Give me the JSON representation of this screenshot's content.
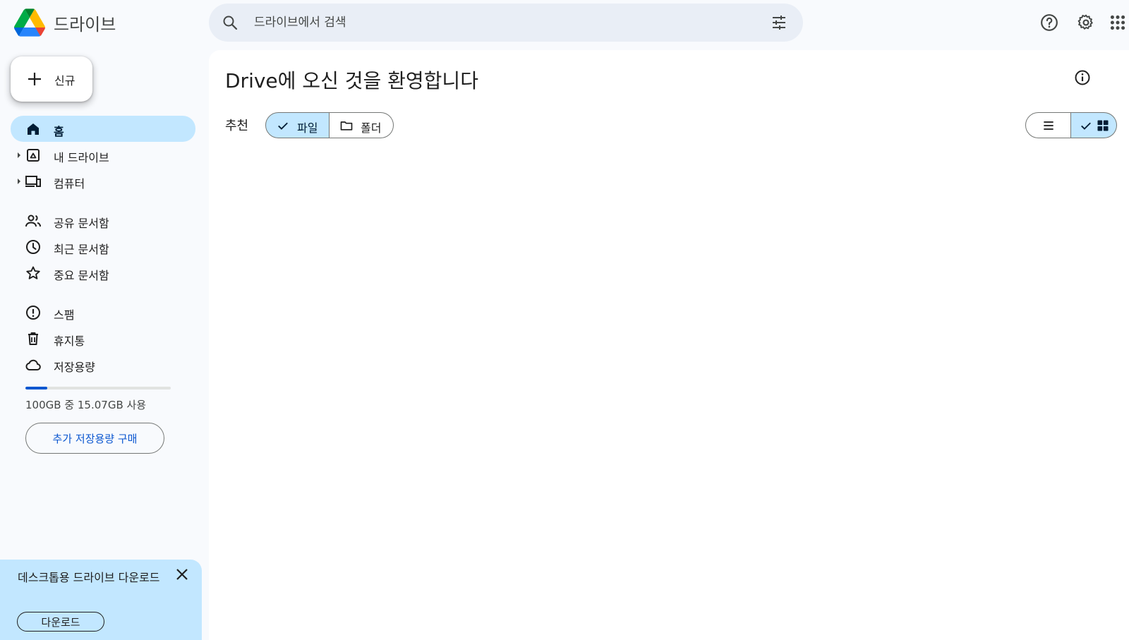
{
  "app": {
    "name": "드라이브",
    "logo_colors": [
      "#0066da",
      "#00ac47",
      "#ea4335",
      "#00832d",
      "#2684fc",
      "#ffba00"
    ]
  },
  "search": {
    "placeholder": "드라이브에서 검색",
    "value": ""
  },
  "header": {
    "icons": [
      "help-icon",
      "settings-icon",
      "apps-grid-icon"
    ]
  },
  "sidebar": {
    "new_label": "신규",
    "items": [
      {
        "label": "홈",
        "icon": "home-icon",
        "active": true
      },
      {
        "label": "내 드라이브",
        "icon": "my-drive-icon",
        "expandable": true
      },
      {
        "label": "컴퓨터",
        "icon": "computers-icon",
        "expandable": true
      },
      {
        "label": "공유 문서함",
        "icon": "shared-icon"
      },
      {
        "label": "최근 문서함",
        "icon": "clock-icon"
      },
      {
        "label": "중요 문서함",
        "icon": "star-icon"
      },
      {
        "label": "스팸",
        "icon": "spam-icon"
      },
      {
        "label": "휴지통",
        "icon": "trash-icon"
      },
      {
        "label": "저장용량",
        "icon": "cloud-icon"
      }
    ],
    "storage": {
      "text": "100GB 중 15.07GB 사용",
      "used_fraction": 0.1507
    },
    "buy_storage_label": "추가 저장용량 구매"
  },
  "promo": {
    "text": "데스크톱용 드라이브 다운로드",
    "button_label": "다운로드"
  },
  "main": {
    "title": "Drive에 오신 것을 환영합니다",
    "suggested_label": "추천",
    "filters": [
      {
        "label": "파일",
        "selected": true
      },
      {
        "label": "폴더",
        "selected": false
      }
    ],
    "view_mode": "grid"
  },
  "colors": {
    "accent": "#0b57d0",
    "active_bg": "#c2e7ff",
    "search_bg": "#e9eef6",
    "page_bg": "#f8fafd"
  }
}
